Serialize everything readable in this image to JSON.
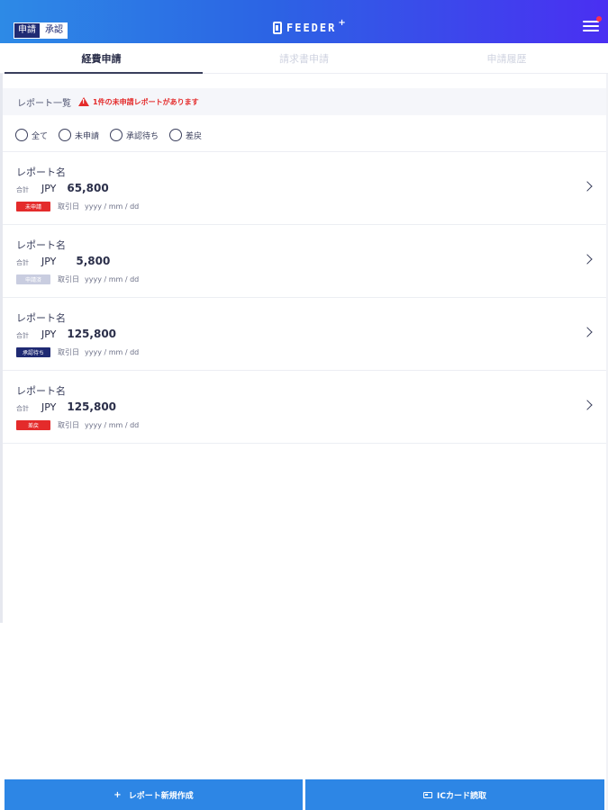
{
  "header": {
    "segment": {
      "active_label": "申請",
      "inactive_label": "承認"
    },
    "logo_text": "FEEDER",
    "logo_plus": "+"
  },
  "tabs": [
    {
      "label": "経費申請",
      "active": true
    },
    {
      "label": "請求書申請",
      "active": false
    },
    {
      "label": "申請履歴",
      "active": false
    }
  ],
  "list_bar": {
    "title": "レポート一覧",
    "warning": "1件の未申請レポートがあります"
  },
  "filters": [
    {
      "label": "全て"
    },
    {
      "label": "未申請"
    },
    {
      "label": "承認待ち"
    },
    {
      "label": "差戻"
    }
  ],
  "reports": [
    {
      "name": "レポート名",
      "total_label": "合計",
      "currency": "JPY",
      "amount": "65,800",
      "badge": "未申請",
      "badge_color": "#e42b2b",
      "date_label": "取引日",
      "date": "yyyy / mm / dd"
    },
    {
      "name": "レポート名",
      "total_label": "合計",
      "currency": "JPY",
      "amount": "5,800",
      "badge": "申請済",
      "badge_color": "#c9cde0",
      "date_label": "取引日",
      "date": "yyyy / mm / dd"
    },
    {
      "name": "レポート名",
      "total_label": "合計",
      "currency": "JPY",
      "amount": "125,800",
      "badge": "承認待ち",
      "badge_color": "#1f2a73",
      "date_label": "取引日",
      "date": "yyyy / mm / dd"
    },
    {
      "name": "レポート名",
      "total_label": "合計",
      "currency": "JPY",
      "amount": "125,800",
      "badge": "差戻",
      "badge_color": "#e42b2b",
      "date_label": "取引日",
      "date": "yyyy / mm / dd"
    }
  ],
  "bottom": {
    "new_report_icon": "+",
    "new_report_label": "レポート新規作成",
    "ic_card_label": "ICカード読取"
  },
  "colors": {
    "header_start": "#2d8ae6",
    "header_end": "#4a2ff2",
    "button": "#2d86e5",
    "warning": "#e42b2b"
  }
}
